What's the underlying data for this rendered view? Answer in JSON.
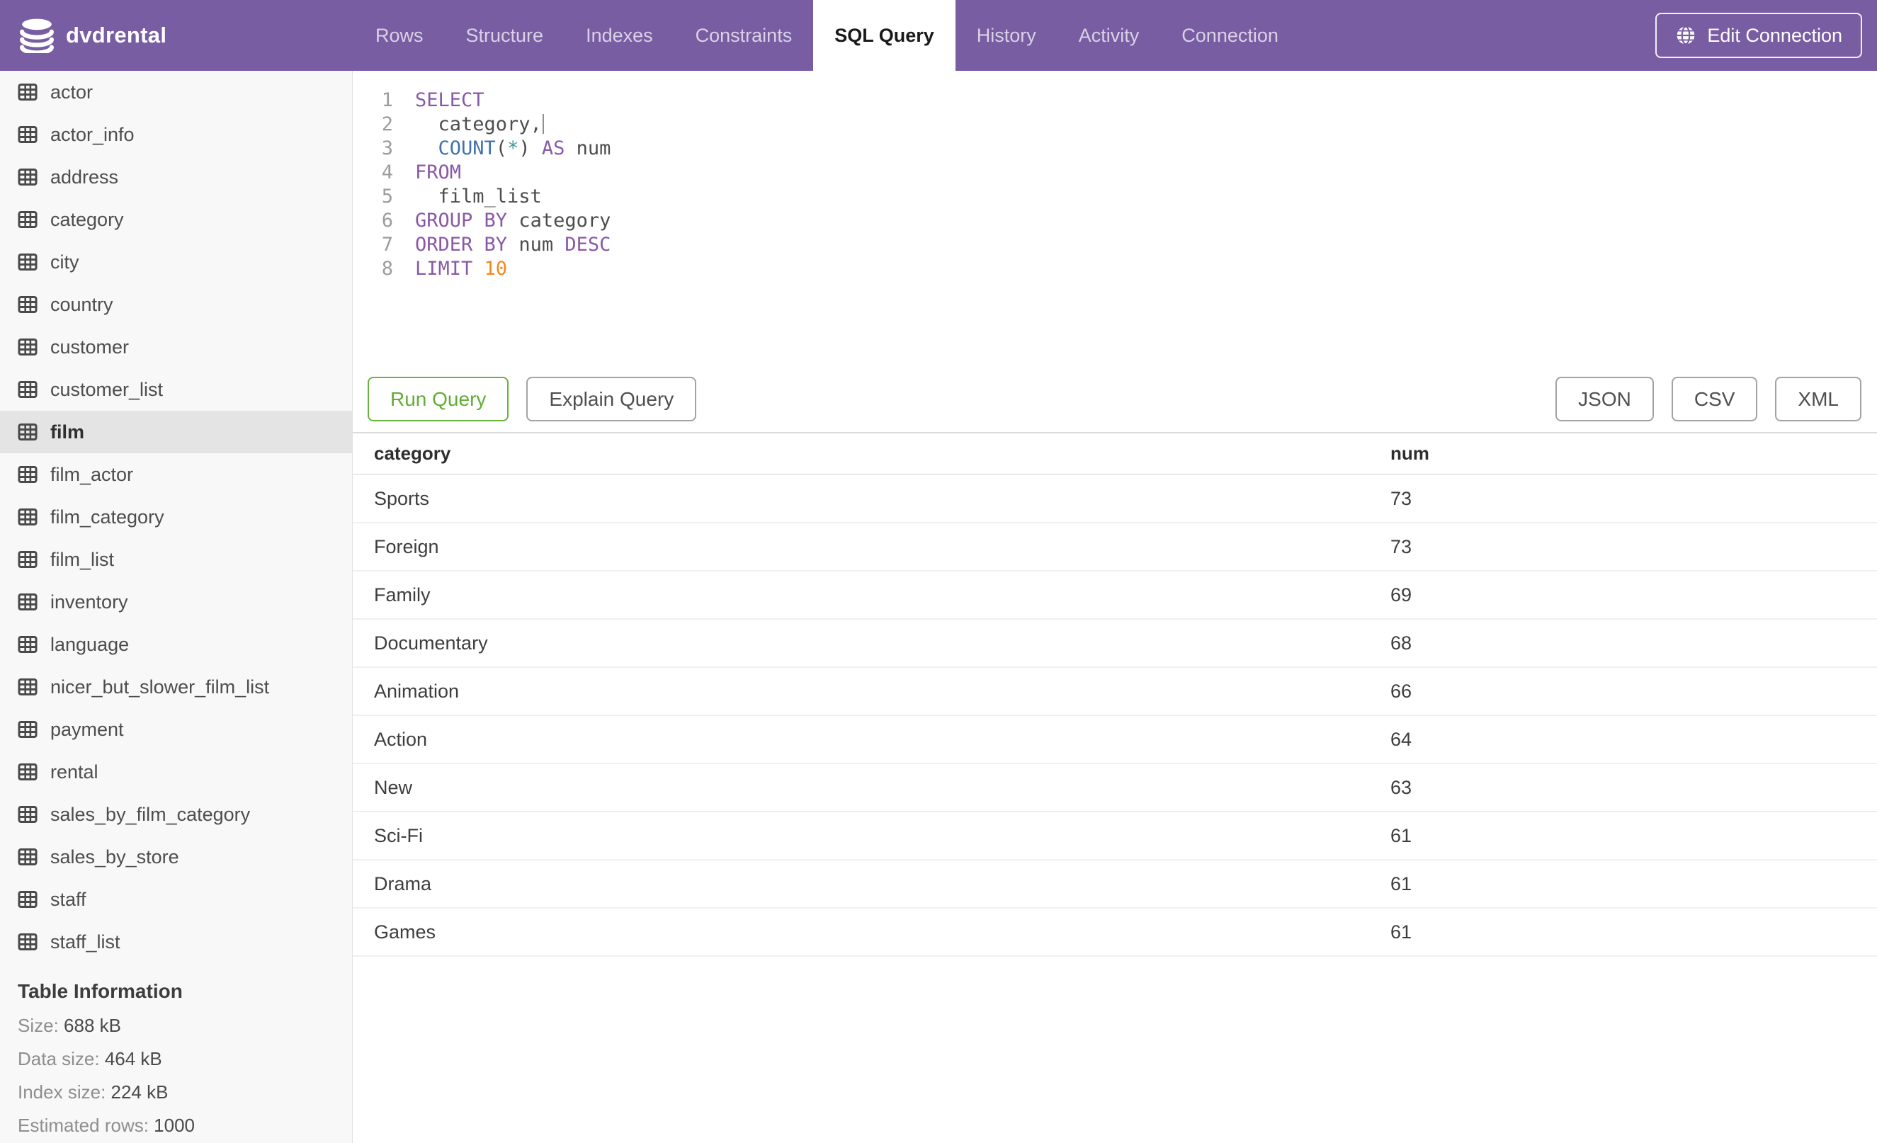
{
  "header": {
    "title": "dvdrental",
    "tabs": [
      "Rows",
      "Structure",
      "Indexes",
      "Constraints",
      "SQL Query",
      "History",
      "Activity",
      "Connection"
    ],
    "active_tab": "SQL Query",
    "edit_connection_label": "Edit Connection"
  },
  "sidebar": {
    "tables": [
      "actor",
      "actor_info",
      "address",
      "category",
      "city",
      "country",
      "customer",
      "customer_list",
      "film",
      "film_actor",
      "film_category",
      "film_list",
      "inventory",
      "language",
      "nicer_but_slower_film_list",
      "payment",
      "rental",
      "sales_by_film_category",
      "sales_by_store",
      "staff",
      "staff_list"
    ],
    "selected_table": "film",
    "table_information": {
      "heading": "Table Information",
      "rows": [
        {
          "label": "Size:",
          "value": "688 kB"
        },
        {
          "label": "Data size:",
          "value": "464 kB"
        },
        {
          "label": "Index size:",
          "value": "224 kB"
        },
        {
          "label": "Estimated rows:",
          "value": "1000"
        }
      ]
    }
  },
  "editor": {
    "lines": [
      {
        "n": "1",
        "tokens": [
          [
            "SELECT",
            "kw"
          ]
        ]
      },
      {
        "n": "2",
        "tokens": [
          [
            "  category,",
            "txt"
          ],
          [
            "",
            "caret"
          ]
        ]
      },
      {
        "n": "3",
        "tokens": [
          [
            "  ",
            "txt"
          ],
          [
            "COUNT",
            "fn"
          ],
          [
            "(",
            "txt"
          ],
          [
            "*",
            "star"
          ],
          [
            ")",
            "txt"
          ],
          [
            " ",
            "txt"
          ],
          [
            "AS",
            "kw"
          ],
          [
            " num",
            "txt"
          ]
        ]
      },
      {
        "n": "4",
        "tokens": [
          [
            "FROM",
            "kw"
          ]
        ]
      },
      {
        "n": "5",
        "tokens": [
          [
            "  film_list",
            "txt"
          ]
        ]
      },
      {
        "n": "6",
        "tokens": [
          [
            "GROUP",
            "kw"
          ],
          [
            " ",
            "txt"
          ],
          [
            "BY",
            "kw"
          ],
          [
            " category",
            "txt"
          ]
        ]
      },
      {
        "n": "7",
        "tokens": [
          [
            "ORDER",
            "kw"
          ],
          [
            " ",
            "txt"
          ],
          [
            "BY",
            "kw"
          ],
          [
            " num ",
            "txt"
          ],
          [
            "DESC",
            "kw"
          ]
        ]
      },
      {
        "n": "8",
        "tokens": [
          [
            "LIMIT",
            "kw"
          ],
          [
            " ",
            "txt"
          ],
          [
            "10",
            "num"
          ]
        ]
      }
    ]
  },
  "actions": {
    "run": "Run Query",
    "explain": "Explain Query",
    "exports": [
      "JSON",
      "CSV",
      "XML"
    ]
  },
  "results": {
    "columns": [
      "category",
      "num"
    ],
    "rows": [
      [
        "Sports",
        "73"
      ],
      [
        "Foreign",
        "73"
      ],
      [
        "Family",
        "69"
      ],
      [
        "Documentary",
        "68"
      ],
      [
        "Animation",
        "66"
      ],
      [
        "Action",
        "64"
      ],
      [
        "New",
        "63"
      ],
      [
        "Sci-Fi",
        "61"
      ],
      [
        "Drama",
        "61"
      ],
      [
        "Games",
        "61"
      ]
    ]
  },
  "colors": {
    "navbar": "#795da3",
    "run_button_green": "#6cb33e",
    "selected_item_bg": "#e4e4e4",
    "sql_keyword": "#8959a8",
    "sql_function": "#4271ae",
    "sql_star": "#3e999f",
    "sql_number": "#f5871f"
  }
}
